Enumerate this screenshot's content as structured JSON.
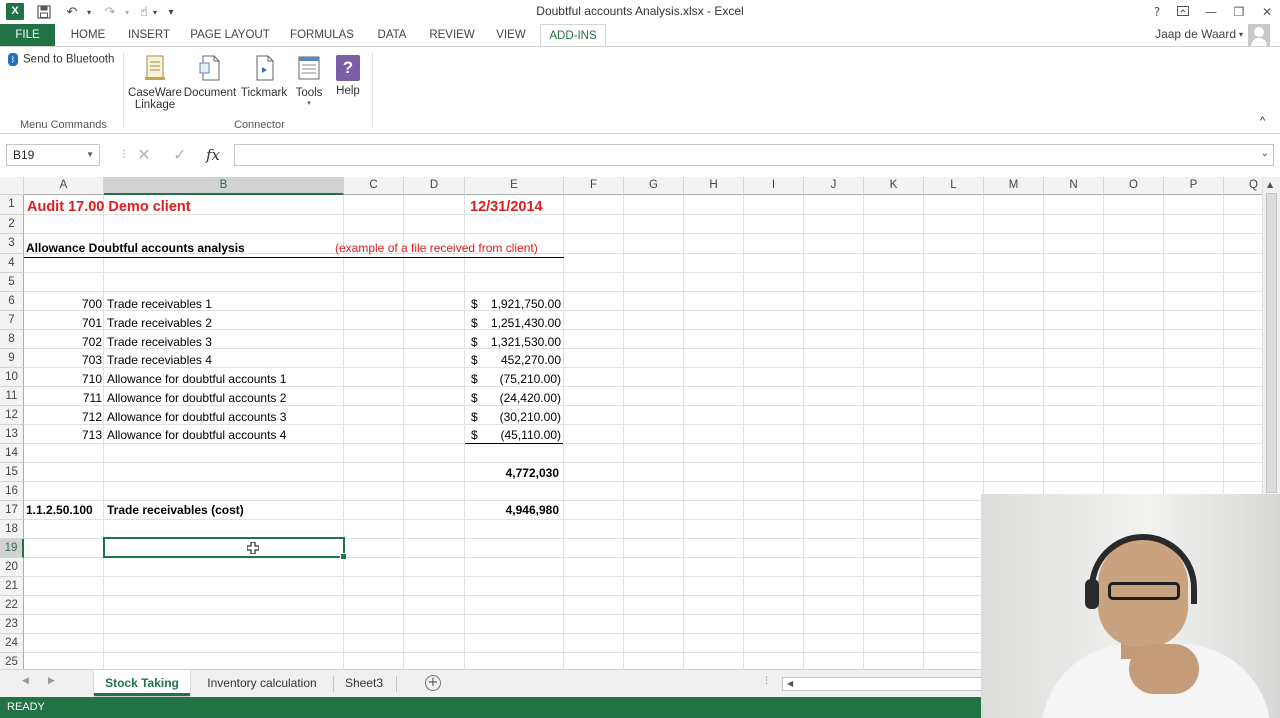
{
  "window": {
    "title": "Doubtful accounts Analysis.xlsx - Excel",
    "help": "?",
    "min": "—",
    "restore": "❐",
    "close": "✕"
  },
  "quick_access": {
    "app_icon": "X",
    "save": "💾",
    "undo": "↶",
    "redo": "↷",
    "touch": "☝",
    "customize": "▾"
  },
  "tabs": [
    "FILE",
    "HOME",
    "INSERT",
    "PAGE LAYOUT",
    "FORMULAS",
    "DATA",
    "REVIEW",
    "VIEW",
    "ADD-INS"
  ],
  "user_name": "Jaap de Waard",
  "ribbon": {
    "bluetooth_label": "Send to Bluetooth",
    "group1_label": "Menu Commands",
    "group2_label": "Connector",
    "items": [
      {
        "label": "CaseWare",
        "label2": "Linkage",
        "icon": "caseware-icon"
      },
      {
        "label": "Document",
        "icon": "document-icon"
      },
      {
        "label": "Tickmark",
        "icon": "tickmark-icon"
      },
      {
        "label": "Tools",
        "icon": "tools-icon"
      },
      {
        "label": "Help",
        "icon": "help-icon"
      }
    ],
    "collapse": "^"
  },
  "formula_bar": {
    "name_box": "B19",
    "cancel": "✕",
    "enter": "✓",
    "fx": "fx",
    "content": ""
  },
  "columns": [
    "A",
    "B",
    "C",
    "D",
    "E",
    "F",
    "G",
    "H",
    "I",
    "J",
    "K",
    "L",
    "M",
    "N",
    "O",
    "P",
    "Q"
  ],
  "rows": [
    "1",
    "2",
    "3",
    "4",
    "5",
    "6",
    "7",
    "8",
    "9",
    "10",
    "11",
    "12",
    "13",
    "14",
    "15",
    "16",
    "17",
    "18",
    "19",
    "20",
    "21",
    "22",
    "23",
    "24",
    "25"
  ],
  "sheet": {
    "title": "Audit 17.00 Demo client",
    "date": "12/31/2014",
    "subtitle": "Allowance Doubtful accounts analysis",
    "note": "(example of a file received from client)",
    "lines": [
      {
        "code": "700",
        "desc": "Trade receivables 1",
        "cur": "$",
        "amount": "1,921,750.00"
      },
      {
        "code": "701",
        "desc": "Trade receivables 2",
        "cur": "$",
        "amount": "1,251,430.00"
      },
      {
        "code": "702",
        "desc": "Trade receivables 3",
        "cur": "$",
        "amount": "1,321,530.00"
      },
      {
        "code": "703",
        "desc": "Trade receviables 4",
        "cur": "$",
        "amount": "452,270.00"
      },
      {
        "code": "710",
        "desc": "Allowance for doubtful accounts 1",
        "cur": "$",
        "amount": "(75,210.00)"
      },
      {
        "code": "711",
        "desc": "Allowance for doubtful accounts 2",
        "cur": "$",
        "amount": "(24,420.00)"
      },
      {
        "code": "712",
        "desc": "Allowance for doubtful accounts 3",
        "cur": "$",
        "amount": "(30,210.00)"
      },
      {
        "code": "713",
        "desc": "Allowance for doubtful accounts 4",
        "cur": "$",
        "amount": "(45,110.00)"
      }
    ],
    "total": "4,772,030",
    "ref_code": "1.1.2.50.100",
    "ref_desc": "Trade receivables (cost)",
    "ref_amount": "4,946,980"
  },
  "sheet_tabs": [
    "Stock Taking",
    "Inventory calculation",
    "Sheet3"
  ],
  "add_sheet": "+",
  "status": "READY",
  "colors": {
    "excel_green": "#217346",
    "red_text": "#e01b1b"
  }
}
